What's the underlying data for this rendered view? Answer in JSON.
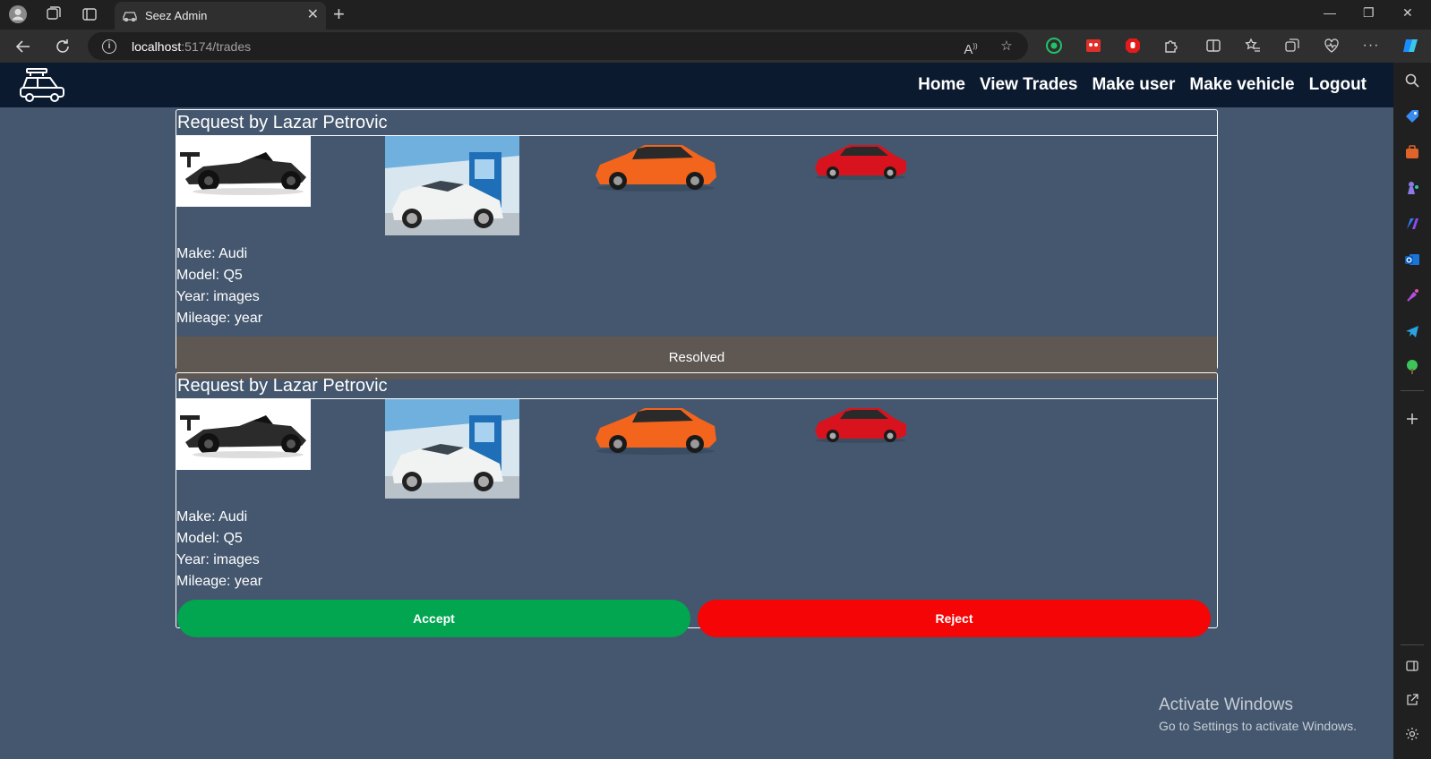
{
  "browser": {
    "tab_title": "Seez Admin",
    "url_host": "localhost",
    "url_rest": ":5174/trades",
    "close_glyph": "✕",
    "new_tab_glyph": "+",
    "minimize_glyph": "—",
    "restore_glyph": "❐",
    "window_close_glyph": "✕"
  },
  "site_nav": {
    "links": [
      "Home",
      "View Trades",
      "Make user",
      "Make vehicle",
      "Logout"
    ]
  },
  "trades": [
    {
      "title": "Request by Lazar Petrovic",
      "make": "Make: Audi",
      "model": "Model: Q5",
      "year": "Year: images",
      "mileage": "Mileage: year",
      "status": "Resolved",
      "images": [
        "race-car-image",
        "white-sedan-image",
        "orange-hatchback-image",
        "red-hatchback-image"
      ]
    },
    {
      "title": "Request by Lazar Petrovic",
      "make": "Make: Audi",
      "model": "Model: Q5",
      "year": "Year: images",
      "mileage": "Mileage: year",
      "accept_label": "Accept",
      "reject_label": "Reject",
      "images": [
        "race-car-image",
        "white-sedan-image",
        "orange-hatchback-image",
        "red-hatchback-image"
      ]
    }
  ],
  "watermark": {
    "title": "Activate Windows",
    "subtitle": "Go to Settings to activate Windows."
  },
  "colors": {
    "page_bg": "#44576e",
    "nav_bg": "#0c1a30",
    "accept": "#02a650",
    "reject": "#f50505",
    "resolved_bg": "#5e5752"
  }
}
